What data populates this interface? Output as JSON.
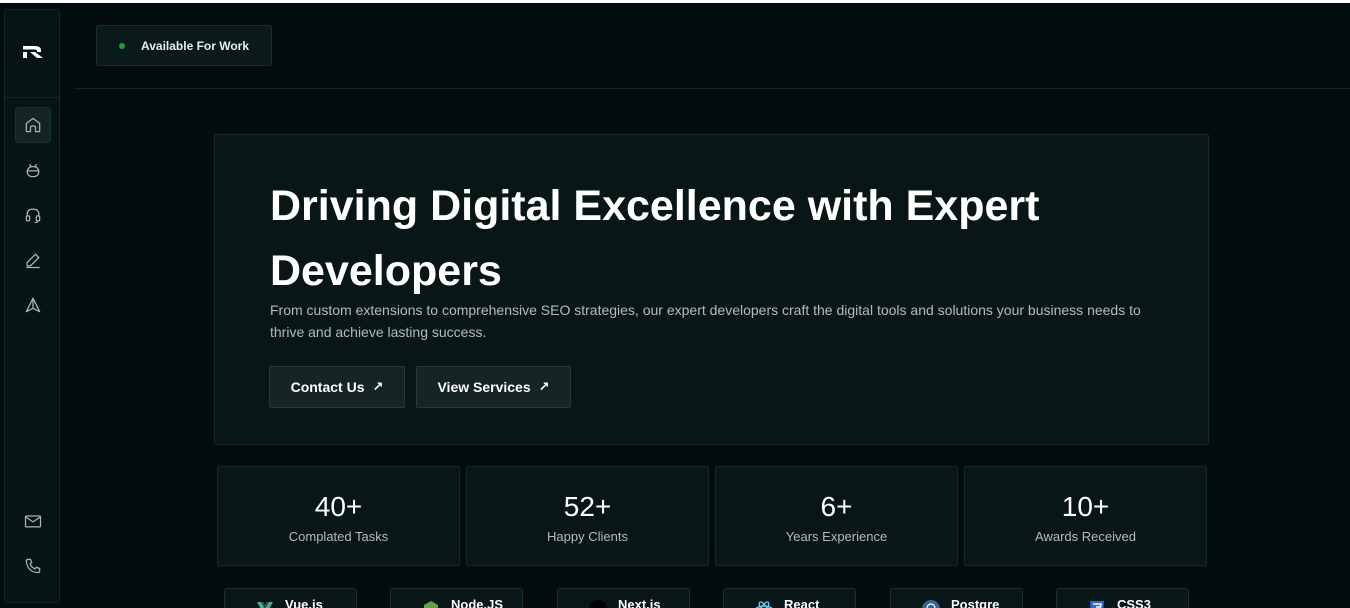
{
  "header": {
    "status_label": "Available For Work",
    "status_color": "#1f9d36"
  },
  "sidebar": {
    "items": [
      {
        "name": "home",
        "icon": "home-icon",
        "active": true
      },
      {
        "name": "android",
        "icon": "android-icon",
        "active": false
      },
      {
        "name": "support",
        "icon": "headset-icon",
        "active": false
      },
      {
        "name": "edit",
        "icon": "pencil-icon",
        "active": false
      },
      {
        "name": "send",
        "icon": "send-icon",
        "active": false
      }
    ],
    "bottom_items": [
      {
        "name": "mail",
        "icon": "mail-icon"
      },
      {
        "name": "phone",
        "icon": "phone-icon"
      }
    ]
  },
  "hero": {
    "title": "Driving Digital Excellence with Expert Developers",
    "description": "From custom extensions to comprehensive SEO strategies, our expert developers craft the digital tools and solutions your business needs to thrive and achieve lasting success.",
    "contact_label": "Contact Us",
    "services_label": "View Services",
    "arrow": "↗"
  },
  "stats": [
    {
      "value": "40+",
      "label": "Complated Tasks"
    },
    {
      "value": "52+",
      "label": "Happy Clients"
    },
    {
      "value": "6+",
      "label": "Years Experience"
    },
    {
      "value": "10+",
      "label": "Awards Received"
    }
  ],
  "tech": [
    {
      "icon": "vue-icon",
      "label": "Vue.js"
    },
    {
      "icon": "nodejs-icon",
      "label": "Node.JS"
    },
    {
      "icon": "nextjs-icon",
      "label": "Next.js"
    },
    {
      "icon": "react-icon",
      "label": "React"
    },
    {
      "icon": "postgres-icon",
      "label": "Postgre"
    },
    {
      "icon": "css3-icon",
      "label": "CSS3"
    }
  ]
}
